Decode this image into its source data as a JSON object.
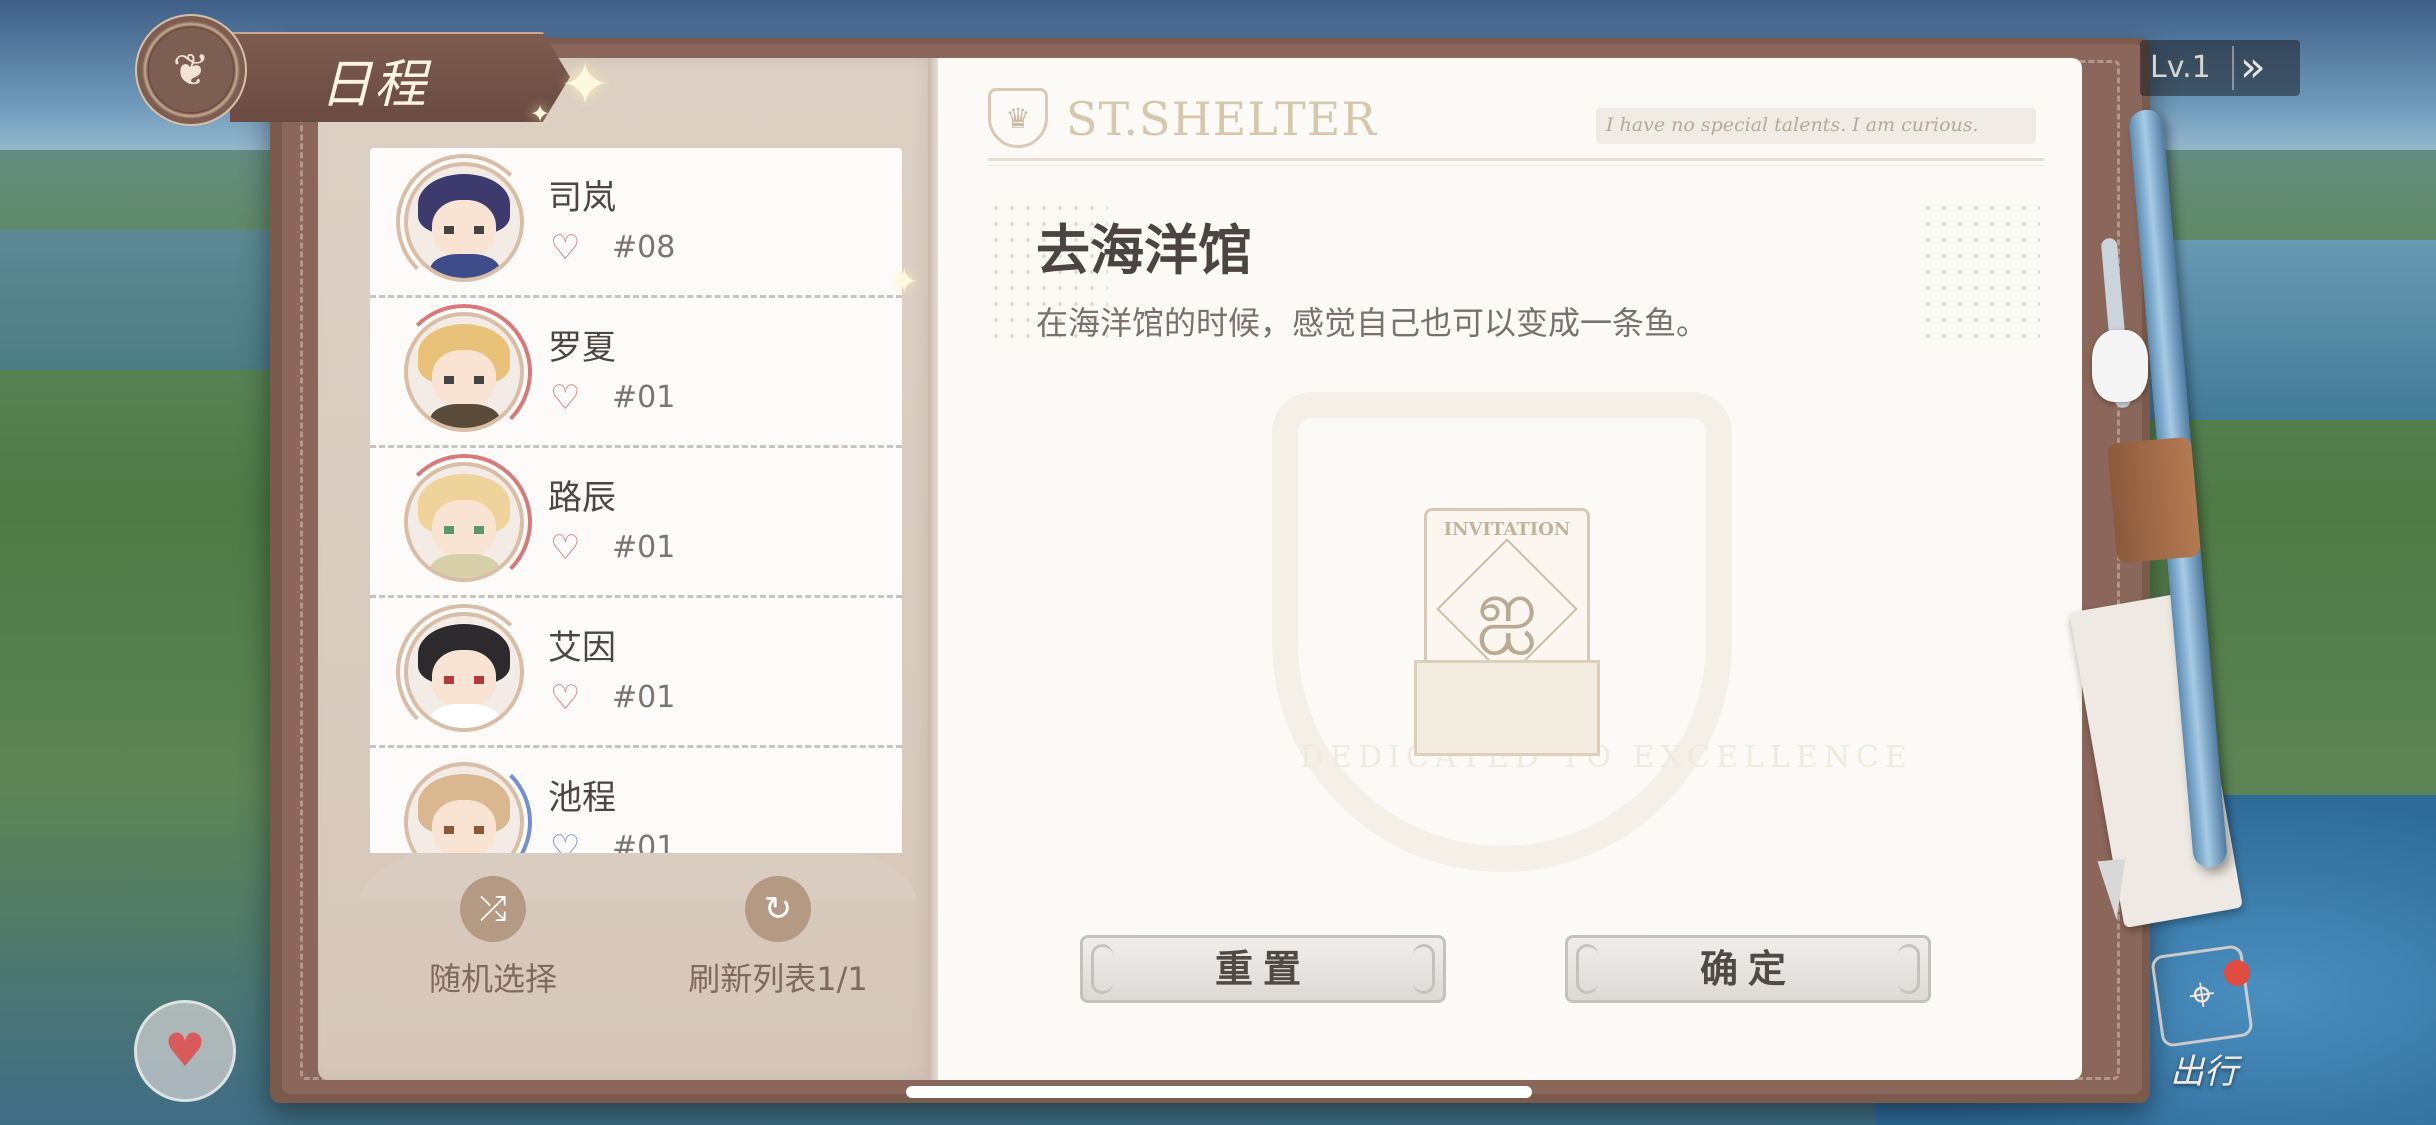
{
  "header": {
    "title": "日程",
    "emblem_icon": "butterfly-icon"
  },
  "level": {
    "text": "Lv.1",
    "arrow_icon": "double-chevron-right-icon"
  },
  "characters": [
    {
      "name": "司岚",
      "number": "#08",
      "hair": "#3d3a6e",
      "ring": "#d9bea5",
      "heart_color": "#d97a7a"
    },
    {
      "name": "罗夏",
      "number": "#01",
      "hair": "#e9c27a",
      "ring": "#d87a7a",
      "heart_color": "#d97a7a"
    },
    {
      "name": "路辰",
      "number": "#01",
      "hair": "#eed49a",
      "ring": "#d87a7a",
      "heart_color": "#d97a7a"
    },
    {
      "name": "艾因",
      "number": "#01",
      "hair": "#2c2a2c",
      "ring": "#d9bea5",
      "heart_color": "#d97a7a"
    },
    {
      "name": "池程",
      "number": "#01",
      "hair": "#d9b78f",
      "ring": "#6f8fd8",
      "heart_color": "#6f8fd8"
    }
  ],
  "left_actions": {
    "random": {
      "label": "随机选择",
      "icon": "shuffle-icon"
    },
    "refresh": {
      "label": "刷新列表1/1",
      "icon": "refresh-icon"
    }
  },
  "right_page": {
    "brand": "ST.SHELTER",
    "quote": "I have no special talents. I am curious.",
    "event_title": "去海洋馆",
    "event_desc": "在海洋馆的时候，感觉自己也可以变成一条鱼。",
    "invitation_label": "INVITATION",
    "watermark_text": "DEDICATED TO EXCELLENCE"
  },
  "buttons": {
    "reset": "重置",
    "confirm": "确定"
  },
  "outing": {
    "label": "出行",
    "icon": "map-pin-icon"
  },
  "colors": {
    "accent": "#8b675b",
    "page": "#fcfaf7",
    "alert": "#e04b3f"
  }
}
